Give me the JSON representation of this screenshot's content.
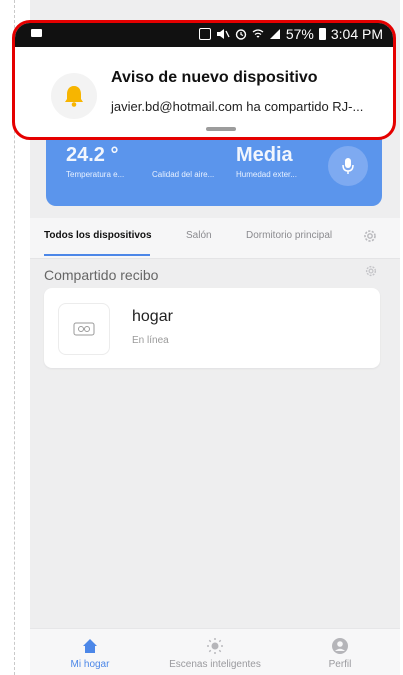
{
  "status_bar": {
    "battery_percent": "57%",
    "time": "3:04 PM"
  },
  "notification": {
    "title": "Aviso de nuevo dispositivo",
    "body": "javier.bd@hotmail.com ha compartido RJ-...",
    "bell_icon": "bell-icon",
    "accent_color": "#f7b500",
    "highlight_border": "#e50000"
  },
  "weather": {
    "temperature_value": "24.2 °",
    "temperature_label": "Temperatura e...",
    "air_quality_label": "Calidad del aire...",
    "humidity_value": "Media",
    "humidity_label": "Humedad exter...",
    "card_color": "#5b95ec"
  },
  "tabs": {
    "items": [
      {
        "label": "Todos los dispositivos"
      },
      {
        "label": "Salón"
      },
      {
        "label": "Dormitorio principal"
      }
    ],
    "active_index": 0
  },
  "section": {
    "title": "Compartido recibo"
  },
  "device": {
    "name": "hogar",
    "status": "En línea"
  },
  "bottom_nav": {
    "items": [
      {
        "label": "Mi hogar",
        "icon": "home-icon"
      },
      {
        "label": "Escenas inteligentes",
        "icon": "sun-icon"
      },
      {
        "label": "Perfil",
        "icon": "profile-icon"
      }
    ],
    "active_color": "#4c87e8"
  }
}
